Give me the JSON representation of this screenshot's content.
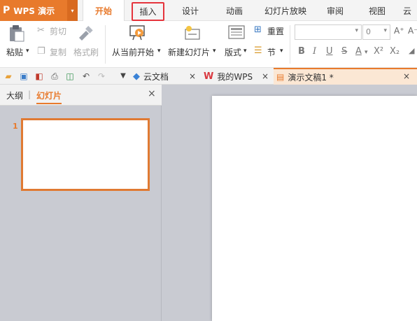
{
  "app": {
    "logo": "P",
    "name": "WPS 演示",
    "drop": "▾"
  },
  "menu": {
    "tabs": [
      "开始",
      "插入",
      "设计",
      "动画",
      "幻灯片放映",
      "审阅",
      "视图",
      "云"
    ]
  },
  "ribbon": {
    "paste": "粘贴",
    "cut": "剪切",
    "copy": "复制",
    "format_painter": "格式刷",
    "from_current": "从当前开始",
    "new_slide": "新建幻灯片",
    "layout": "版式",
    "reset": "重置",
    "section": "节",
    "font_size": "0",
    "grow": "A⁺",
    "shrink": "A⁻",
    "bold": "B",
    "italic": "I",
    "underline": "U",
    "strike": "S",
    "shadow": "S",
    "fontcolor": "A",
    "superscript": "X²",
    "subscript": "X₂",
    "drop": "▾"
  },
  "tabbar": {
    "tabs": [
      {
        "label": "云文档",
        "close": "×"
      },
      {
        "label": "我的WPS",
        "close": "×"
      },
      {
        "label": "演示文稿1 *",
        "close": "×"
      }
    ],
    "more": "▼"
  },
  "leftpane": {
    "tabs": [
      "大纲",
      "幻灯片"
    ],
    "divider": "|",
    "close": "×",
    "slide_number": "1"
  },
  "colors": {
    "accent": "#e87a2c",
    "highlight_box": "#e5343c",
    "thumb_border": "#e07a33",
    "wps_red": "#d9383f"
  }
}
